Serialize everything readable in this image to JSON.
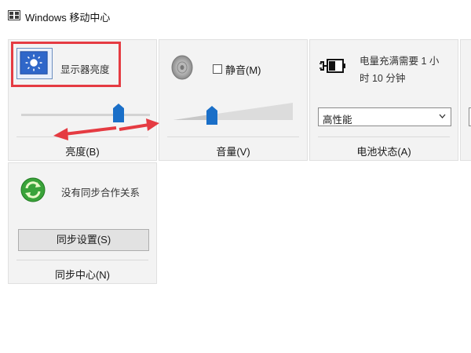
{
  "window": {
    "title": "Windows 移动中心",
    "icon": "mobility-center-icon"
  },
  "tiles": {
    "brightness": {
      "label": "显示器亮度",
      "footer": "亮度(B)",
      "icon": "display-brightness-icon",
      "level": 0.75
    },
    "volume": {
      "mute_label": "静音(M)",
      "mute_checked": false,
      "footer": "音量(V)",
      "icon": "speaker-icon",
      "level": 0.3
    },
    "battery": {
      "status_line1": "电量充满需要 1 小",
      "status_line2": "时 10 分钟",
      "plan_value": "高性能",
      "footer": "电池状态(A)",
      "icon": "battery-plug-icon"
    },
    "sync": {
      "label": "没有同步合作关系",
      "button_label": "同步设置(S)",
      "footer": "同步中心(N)",
      "icon": "sync-icon"
    }
  },
  "annotations": {
    "highlight_color": "#e53b42",
    "arrow_color": "#e53b42"
  },
  "colors": {
    "slider_thumb": "#1a6fc8",
    "tile_bg": "#f3f3f3"
  }
}
